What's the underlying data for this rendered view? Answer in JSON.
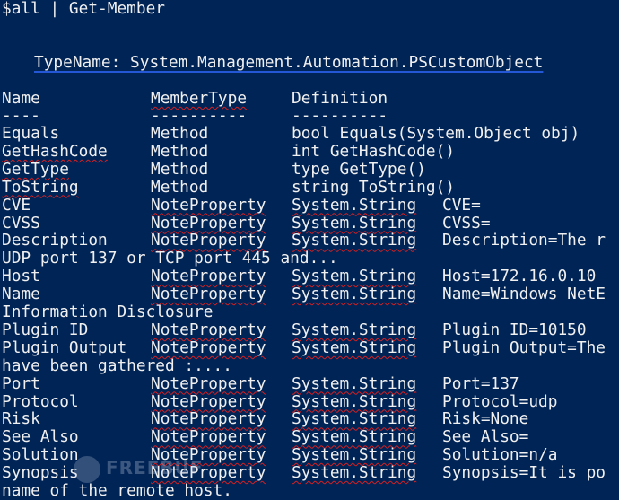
{
  "colors": {
    "background": "#012456",
    "text": "#f0f0f0",
    "spellcheck_red": "#d61f1f",
    "link_blue": "#2457d6"
  },
  "command": "$all | Get-Member",
  "typename": "TypeName: System.Management.Automation.PSCustomObject",
  "headers": [
    "Name",
    "MemberType",
    "Definition"
  ],
  "separators": [
    "----",
    "----------",
    "----------"
  ],
  "members": [
    {
      "name": "Equals",
      "type": "Method",
      "def": "bool Equals(System.Object obj)"
    },
    {
      "name": "GetHashCode",
      "type": "Method",
      "def": "int GetHashCode()"
    },
    {
      "name": "GetType",
      "type": "Method",
      "def": "type GetType()"
    },
    {
      "name": "ToString",
      "type": "Method",
      "def": "string ToString()"
    },
    {
      "name": "CVE",
      "type": "NoteProperty",
      "def1": "System.String",
      "def2": "CVE="
    },
    {
      "name": "CVSS",
      "type": "NoteProperty",
      "def1": "System.String",
      "def2": "CVSS="
    },
    {
      "name": "Description",
      "type": "NoteProperty",
      "def1": "System.String",
      "def2": "Description=The r"
    },
    {
      "wrap": "UDP port 137 or TCP port 445 and..."
    },
    {
      "name": "Host",
      "type": "NoteProperty",
      "def1": "System.String",
      "def2": "Host=172.16.0.10"
    },
    {
      "name": "Name",
      "type": "NoteProperty",
      "def1": "System.String",
      "def2": "Name=Windows NetE"
    },
    {
      "wrap": "Information Disclosure"
    },
    {
      "name": "Plugin ID",
      "type": "NoteProperty",
      "def1": "System.String",
      "def2": "Plugin ID=10150"
    },
    {
      "name": "Plugin Output",
      "type": "NoteProperty",
      "def1": "System.String",
      "def2": "Plugin Output=The"
    },
    {
      "wrap": "have been gathered :...."
    },
    {
      "name": "Port",
      "type": "NoteProperty",
      "def1": "System.String",
      "def2": "Port=137"
    },
    {
      "name": "Protocol",
      "type": "NoteProperty",
      "def1": "System.String",
      "def2": "Protocol=udp"
    },
    {
      "name": "Risk",
      "type": "NoteProperty",
      "def1": "System.String",
      "def2": "Risk=None"
    },
    {
      "name": "See Also",
      "type": "NoteProperty",
      "def1": "System.String",
      "def2": "See Also="
    },
    {
      "name": "Solution",
      "type": "NoteProperty",
      "def1": "System.String",
      "def2": "Solution=n/a"
    },
    {
      "name": "Synopsis",
      "type": "NoteProperty",
      "def1": "System.String",
      "def2": "Synopsis=It is po"
    },
    {
      "wrap": "name of the remote host."
    }
  ]
}
